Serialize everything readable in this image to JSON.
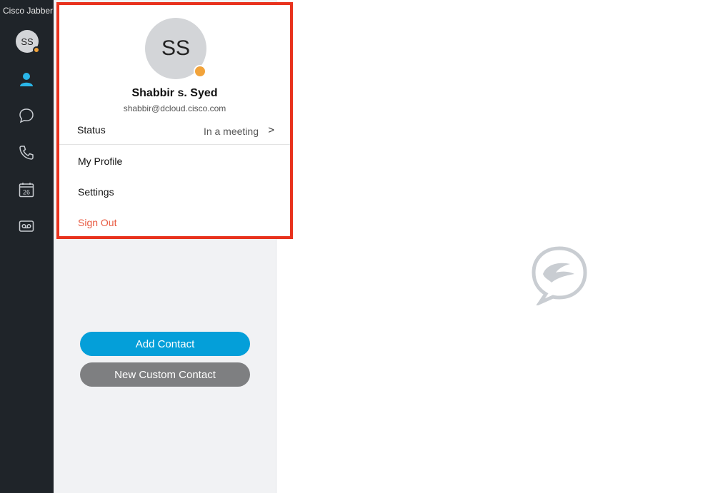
{
  "app": {
    "title": "Cisco Jabber"
  },
  "user": {
    "initials": "SS",
    "name": "Shabbir s. Syed",
    "email": "shabbir@dcloud.cisco.com",
    "presence_color": "#f2a33a"
  },
  "sidebar": {
    "items": [
      {
        "icon": "contacts-icon",
        "active": true
      },
      {
        "icon": "chat-icon"
      },
      {
        "icon": "phone-icon"
      },
      {
        "icon": "calendar-icon",
        "label": "26"
      },
      {
        "icon": "voicemail-icon"
      }
    ]
  },
  "popup": {
    "status_label": "Status",
    "status_value": "In a meeting",
    "status_chevron": ">",
    "my_profile": "My Profile",
    "settings": "Settings",
    "sign_out": "Sign Out"
  },
  "contacts_panel": {
    "add_contact": "Add Contact",
    "new_custom_contact": "New Custom Contact"
  },
  "colors": {
    "accent": "#049fd9",
    "sidebar_bg": "#1f2429",
    "highlight_border": "#e8321d",
    "sign_out": "#e85a41"
  }
}
